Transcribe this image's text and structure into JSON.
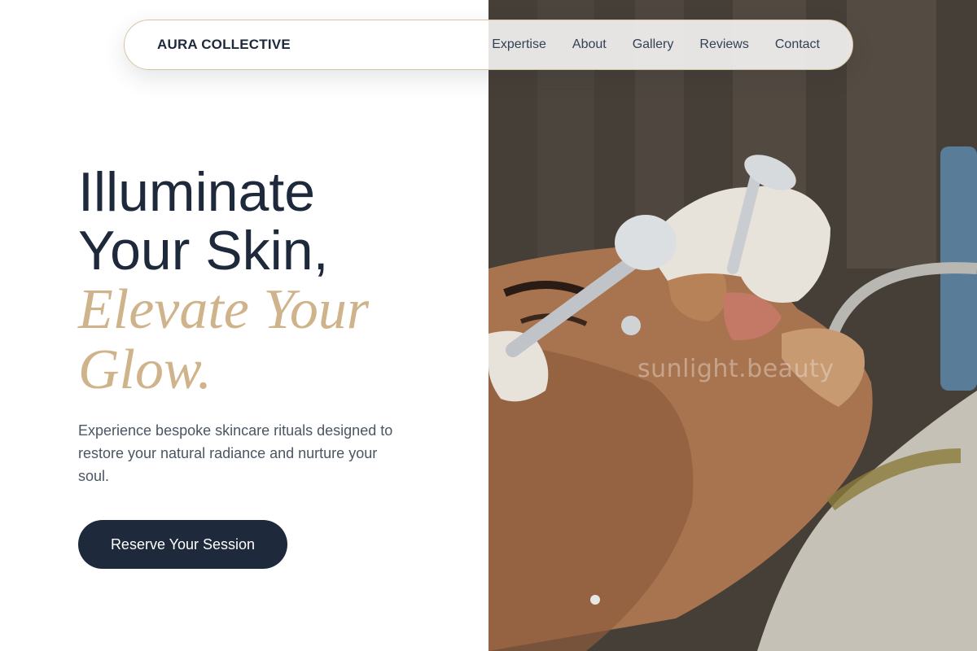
{
  "header": {
    "brand": "AURA COLLECTIVE",
    "nav": [
      "Expertise",
      "About",
      "Gallery",
      "Reviews",
      "Contact"
    ]
  },
  "hero": {
    "title_line1": "Illuminate",
    "title_line2": "Your Skin,",
    "accent_line1": "Elevate Your",
    "accent_line2": "Glow.",
    "description": "Experience bespoke skincare rituals designed to restore your natural radiance and nurture your soul.",
    "cta_label": "Reserve Your Session"
  },
  "image": {
    "watermark": "sunlight.beauty",
    "subject": "facial-treatment-photo"
  },
  "colors": {
    "navy": "#1e293b",
    "gold_accent": "#cfb38a",
    "nav_border": "#d6c4a3",
    "body_text": "#4b5563"
  }
}
